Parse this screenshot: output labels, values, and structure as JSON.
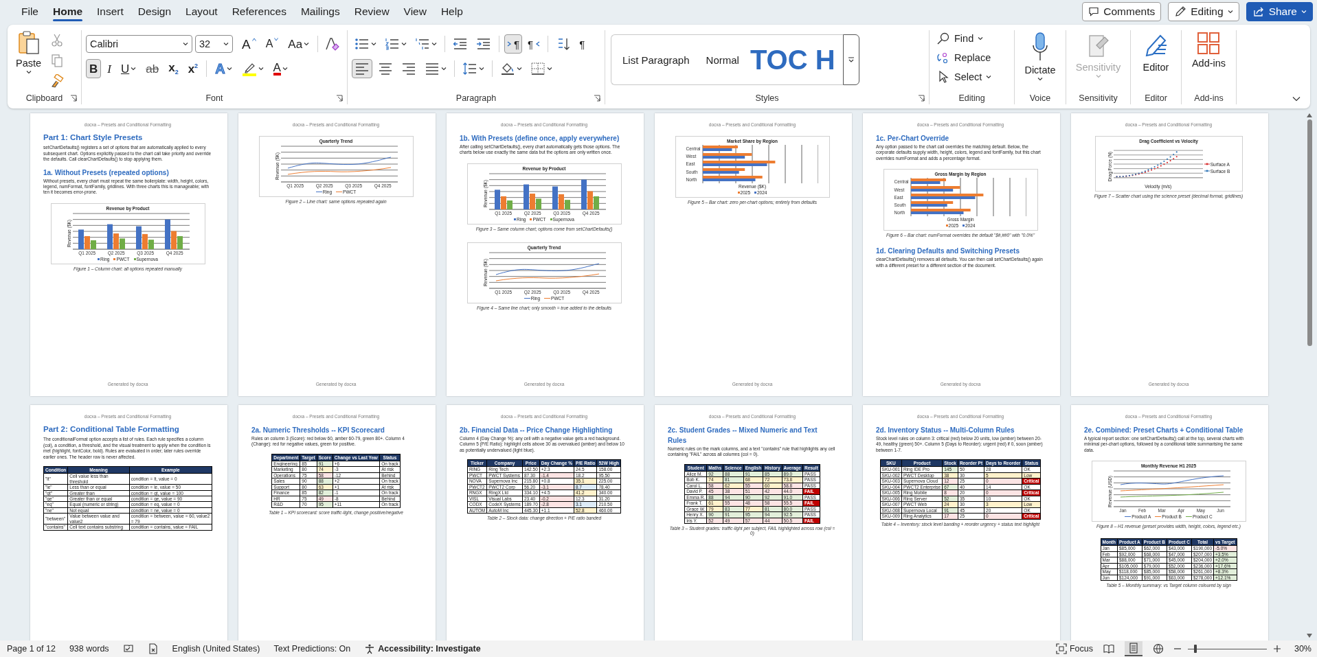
{
  "menu_tabs": [
    {
      "label": "File",
      "selected": false
    },
    {
      "label": "Home",
      "selected": true
    },
    {
      "label": "Insert",
      "selected": false
    },
    {
      "label": "Design",
      "selected": false
    },
    {
      "label": "Layout",
      "selected": false
    },
    {
      "label": "References",
      "selected": false
    },
    {
      "label": "Mailings",
      "selected": false
    },
    {
      "label": "Review",
      "selected": false
    },
    {
      "label": "View",
      "selected": false
    },
    {
      "label": "Help",
      "selected": false
    }
  ],
  "top_buttons": [
    {
      "label": "Comments",
      "kind": "comments"
    },
    {
      "label": "Editing",
      "kind": "editing"
    },
    {
      "label": "Share",
      "kind": "share"
    }
  ],
  "ribbon": {
    "clipboard": {
      "group": "Clipboard",
      "paste": "Paste"
    },
    "font": {
      "group": "Font",
      "name": "Calibri",
      "size": "32",
      "row1": [
        {
          "label": "A",
          "kind": "grow"
        },
        {
          "label": "A",
          "kind": "shrink"
        },
        {
          "label": "Aa",
          "kind": "case"
        }
      ],
      "row2": [
        {
          "label": "B",
          "kind": "bold",
          "selected": true
        },
        {
          "label": "I",
          "kind": "italic",
          "selected": false
        },
        {
          "label": "U",
          "kind": "underline",
          "selected": false
        },
        {
          "label": "ab",
          "kind": "strike",
          "selected": false
        },
        {
          "label": "x$_{2}$",
          "kind": "sub",
          "selected": false
        },
        {
          "label": "x$^{2}$",
          "kind": "sup",
          "selected": false
        },
        {
          "label": "A",
          "kind": "effects",
          "selected": false
        },
        {
          "kind": "highlight",
          "selected": false
        },
        {
          "label": "A",
          "kind": "fontcolor",
          "selected": false
        }
      ]
    },
    "paragraph": {
      "group": "Paragraph",
      "row1": [
        {
          "kind": "bullets",
          "selected": false
        },
        {
          "kind": "numbering",
          "selected": false
        },
        {
          "kind": "multilevel",
          "selected": false
        },
        {
          "kind": "outdent",
          "selected": false
        },
        {
          "kind": "indent",
          "selected": false
        },
        {
          "kind": "ltr",
          "label": "¶",
          "selected": true
        },
        {
          "kind": "rtl",
          "label": "¶",
          "selected": false
        },
        {
          "kind": "sort",
          "selected": false
        },
        {
          "kind": "marks",
          "label": "¶",
          "selected": false
        }
      ],
      "row2": [
        {
          "kind": "left",
          "selected": true
        },
        {
          "kind": "center",
          "selected": false
        },
        {
          "kind": "right",
          "selected": false
        },
        {
          "kind": "justify",
          "selected": false
        },
        {
          "kind": "spacing",
          "selected": false
        },
        {
          "kind": "shading",
          "selected": false
        },
        {
          "kind": "borders",
          "selected": false
        }
      ]
    },
    "styles": {
      "group": "Styles",
      "items": [
        {
          "label": "List Paragraph",
          "kind": "plain"
        },
        {
          "label": "Normal",
          "kind": "plain"
        },
        {
          "label": "TOC H",
          "kind": "heading"
        }
      ]
    },
    "editing": {
      "group": "Editing",
      "items": [
        {
          "label": "Find",
          "kind": "find"
        },
        {
          "label": "Replace",
          "kind": "replace"
        },
        {
          "label": "Select",
          "kind": "select"
        }
      ]
    },
    "big": [
      {
        "group": "Voice",
        "label": "Dictate",
        "kind": "mic",
        "disabled": false
      },
      {
        "group": "Sensitivity",
        "label": "Sensitivity",
        "kind": "sensitivity",
        "disabled": true
      },
      {
        "group": "Editor",
        "label": "Editor",
        "kind": "editor",
        "disabled": false
      },
      {
        "group": "Add-ins",
        "label": "Add-ins",
        "kind": "addins",
        "disabled": false
      }
    ]
  },
  "pages": [
    {
      "header": "docxa – Presets and Conditional Formatting",
      "footer": "Generated by docxa",
      "blocks": [
        {
          "kind": "h1",
          "text": "Part 1: Chart Style Presets"
        },
        {
          "kind": "para",
          "text": "setChartDefaults() registers a set of options that are automatically applied to every subsequent chart. Options explicitly passed to the chart call take priority and override the defaults. Call clearChartDefaults() to stop applying them."
        },
        {
          "kind": "h2",
          "text": "1a. Without Presets (repeated options)"
        },
        {
          "kind": "para",
          "text": "Without presets, every chart must repeat the same boilerplate: width, height, colors, legend, numFormat, fontFamily, gridlines. With three charts this is manageable; with ten it becomes error-prone."
        },
        {
          "kind": "chart",
          "chart": {
            "kind": "column",
            "title": "Revenue by Product",
            "ylabel": "Revenue ($K)",
            "categories": [
              "Q1 2025",
              "Q2 2025",
              "Q3 2025",
              "Q4 2025"
            ],
            "legend": [
              "Ring",
              "PWCT",
              "Supernova"
            ]
          }
        },
        {
          "kind": "caption",
          "text": "Figure 1 – Column chart: all options repeated manually"
        }
      ]
    },
    {
      "header": "docxa – Presets and Conditional Formatting",
      "footer": "Generated by docxa",
      "blocks": [
        {
          "kind": "chart",
          "chart": {
            "kind": "line",
            "title": "Quarterly Trend",
            "ylabel": "Revenue ($K)",
            "categories": [
              "Q1 2025",
              "Q2 2025",
              "Q3 2025",
              "Q4 2025"
            ],
            "legend": [
              "Ring",
              "PWCT"
            ]
          }
        },
        {
          "kind": "caption",
          "text": "Figure 2 – Line chart: same options repeated again"
        }
      ]
    },
    {
      "header": "docxa – Presets and Conditional Formatting",
      "footer": "Generated by docxa",
      "blocks": [
        {
          "kind": "h2",
          "text": "1b. With Presets (define once, apply everywhere)"
        },
        {
          "kind": "para",
          "text": "After calling setChartDefaults(), every chart automatically gets those options. The charts below use exactly the same data but the options are only written once."
        },
        {
          "kind": "chart",
          "chart": {
            "kind": "column",
            "title": "Revenue by Product",
            "ylabel": "Revenue ($K)",
            "categories": [
              "Q1 2025",
              "Q2 2025",
              "Q3 2025",
              "Q4 2025"
            ],
            "legend": [
              "Ring",
              "PWCT",
              "Supernova"
            ]
          }
        },
        {
          "kind": "caption",
          "text": "Figure 3 – Same column chart; options come from setChartDefaults()"
        },
        {
          "kind": "chart",
          "chart": {
            "kind": "line",
            "title": "Quarterly Trend",
            "ylabel": "Revenue ($K)",
            "categories": [
              "Q1 2025",
              "Q2 2025",
              "Q3 2025",
              "Q4 2025"
            ],
            "legend": [
              "Ring",
              "PWCT"
            ]
          }
        },
        {
          "kind": "caption",
          "text": "Figure 4 – Same line chart; only smooth = true added to the defaults"
        }
      ]
    },
    {
      "header": "docxa – Presets and Conditional Formatting",
      "footer": "Generated by docxa",
      "blocks": [
        {
          "kind": "chart",
          "chart": {
            "kind": "hbar",
            "title": "Market Share by Region",
            "xlabel": "Revenue ($K)",
            "categories": [
              "Central",
              "West",
              "East",
              "South",
              "North"
            ],
            "legend": [
              "2025",
              "2024"
            ]
          }
        },
        {
          "kind": "caption",
          "text": "Figure 5 – Bar chart: zero per-chart options; entirely from defaults"
        }
      ]
    },
    {
      "header": "docxa – Presets and Conditional Formatting",
      "footer": "Generated by docxa",
      "blocks": [
        {
          "kind": "h2",
          "text": "1c. Per-Chart Override"
        },
        {
          "kind": "para",
          "text": "Any option passed to the chart call overrides the matching default. Below, the corporate defaults supply width, height, colors, legend and fontFamily, but this chart overrides numFormat and adds a percentage format."
        },
        {
          "kind": "chart",
          "chart": {
            "kind": "hbar",
            "title": "Gross Margin by Region",
            "xlabel": "Gross Margin",
            "categories": [
              "Central",
              "West",
              "East",
              "South",
              "North"
            ],
            "legend": [
              "2025",
              "2024"
            ]
          }
        },
        {
          "kind": "caption",
          "text": "Figure 6 – Bar chart: numFormat overrides the default \"$#,##0\" with \"0.0%\""
        },
        {
          "kind": "h2",
          "text": "1d. Clearing Defaults and Switching Presets"
        },
        {
          "kind": "para",
          "text": "clearChartDefaults() removes all defaults. You can then call setChartDefaults() again with a different preset for a different section of the document."
        }
      ]
    },
    {
      "header": "docxa – Presets and Conditional Formatting",
      "footer": "Generated by docxa",
      "blocks": [
        {
          "kind": "chart",
          "chart": {
            "kind": "scatter",
            "title": "Drag Coefficient vs Velocity",
            "ylabel": "Drag Force (N)",
            "xlabel": "Velocity (m/s)",
            "legend": [
              "Surface A",
              "Surface B"
            ]
          }
        },
        {
          "kind": "caption",
          "text": "Figure 7 – Scatter chart using the science preset (decimal format, gridlines)"
        }
      ]
    },
    {
      "header": "docxa – Presets and Conditional Formatting",
      "blocks": [
        {
          "kind": "h1",
          "text": "Part 2: Conditional Table Formatting"
        },
        {
          "kind": "para",
          "text": "The conditionalFormat option accepts a list of rules. Each rule specifies a column (col), a condition, a threshold, and the visual treatment to apply when the condition is met (highlight, fontColor, bold). Rules are evaluated in order; later rules override earlier ones. The header row is never affected."
        },
        {
          "kind": "table",
          "columns": [
            "Condition",
            "Meaning",
            "Example"
          ],
          "rows": [
            [
              "\"lt\"",
              "Cell value less than threshold",
              "condition = lt, value = 0"
            ],
            [
              "\"le\"",
              "Less than or equal",
              "condition = le, value = 50"
            ],
            [
              "\"gt\"",
              "Greater than",
              "condition = gt, value = 100"
            ],
            [
              "\"ge\"",
              "Greater than or equal",
              "condition = ge, value = 90"
            ],
            [
              "\"eq\"",
              "Equal (numeric or string)",
              "condition = eq, value = 0"
            ],
            [
              "\"ne\"",
              "Not equal",
              "condition = ne, value = 0"
            ],
            [
              "\"between\"",
              "Value between value and value2",
              "condition = between, value = 60, value2 = 79"
            ],
            [
              "\"contains\"",
              "Cell text contains substring",
              "condition = contains, value = FAIL"
            ]
          ]
        }
      ]
    },
    {
      "header": "docxa – Presets and Conditional Formatting",
      "blocks": [
        {
          "kind": "h2",
          "text": "2a. Numeric Thresholds -- KPI Scorecard"
        },
        {
          "kind": "para",
          "text": "Rules on column 3 (Score): red below 60, amber 60-79, green 80+. Column 4 (Change): red for negative values, green for positive."
        },
        {
          "kind": "table",
          "columns": [
            "Department",
            "Target",
            "Score",
            "Change vs Last Year",
            "Status"
          ],
          "rows": [
            [
              "Engineering",
              "85",
              {
                "text": "91",
                "color": "#e2efda"
              },
              "+6",
              "On track"
            ],
            [
              "Marketing",
              "80",
              {
                "text": "74",
                "color": "#fff2cc"
              },
              "-3",
              "At risk"
            ],
            [
              "Operations",
              "75",
              {
                "text": "58",
                "color": "#fce4e4"
              },
              "-12",
              "Behind"
            ],
            [
              "Sales",
              "90",
              {
                "text": "88",
                "color": "#e2efda"
              },
              "+2",
              "On track"
            ],
            [
              "Support",
              "80",
              {
                "text": "63",
                "color": "#fff2cc"
              },
              "+1",
              "At risk"
            ],
            [
              "Finance",
              "85",
              {
                "text": "82",
                "color": "#e2efda"
              },
              "-1",
              "On track"
            ],
            [
              "HR",
              "75",
              {
                "text": "49",
                "color": "#fce4e4"
              },
              "-8",
              "Behind"
            ],
            [
              "R&D",
              "70",
              {
                "text": "95",
                "color": "#e2efda"
              },
              "+11",
              "On track"
            ]
          ]
        },
        {
          "kind": "caption",
          "text": "Table 1 – KPI scorecard: score traffic-light, change positive/negative"
        }
      ]
    },
    {
      "header": "docxa – Presets and Conditional Formatting",
      "blocks": [
        {
          "kind": "h2",
          "text": "2b. Financial Data -- Price Change Highlighting"
        },
        {
          "kind": "para",
          "text": "Column 4 (Day Change %): any cell with a negative value gets a red background. Column 5 (P/E Ratio): highlight cells above 30 as overvalued (amber) and below 10 as potentially undervalued (light blue)."
        },
        {
          "kind": "table",
          "columns": [
            "Ticker",
            "Company",
            "Price",
            "Day Change %",
            "P/E Ratio",
            "52W High"
          ],
          "rows": [
            [
              "RING",
              "Ring Tech",
              "142.50",
              "+2.3",
              "24.5",
              "158.00"
            ],
            [
              "PWCT",
              "PWCT Systems",
              "87.30",
              {
                "text": "-1.4",
                "color": "#fce4e4"
              },
              "18.2",
              "95.50"
            ],
            [
              "NOVA",
              "Supernova Inc",
              "215.80",
              "+0.8",
              {
                "text": "35.1",
                "color": "#fff2cc"
              },
              "225.00"
            ],
            [
              "PWCT2",
              "PWCT2 Corp",
              "56.20",
              {
                "text": "-3.1",
                "color": "#fce4e4"
              },
              {
                "text": "8.7",
                "color": "#ddebf7"
              },
              "78.40"
            ],
            [
              "RNGX",
              "RingX Ltd",
              "334.10",
              "+4.5",
              {
                "text": "41.2",
                "color": "#fff2cc"
              },
              "340.00"
            ],
            [
              "VISL",
              "Visual Labs",
              "23.40",
              {
                "text": "-0.2",
                "color": "#fce4e4"
              },
              "12.3",
              "31.20"
            ],
            [
              "CODX",
              "CodeX Systems",
              "189.70",
              {
                "text": "-2.8",
                "color": "#fce4e4"
              },
              {
                "text": "3.1",
                "color": "#ddebf7"
              },
              "210.50"
            ],
            [
              "AUTOM",
              "AutoM Inc",
              "445.30",
              "+1.1",
              {
                "text": "52.8",
                "color": "#fff2cc"
              },
              "460.00"
            ]
          ]
        },
        {
          "kind": "caption",
          "text": "Table 2 – Stock data: change direction + P/E ratio banded"
        }
      ]
    },
    {
      "header": "docxa – Presets and Conditional Formatting",
      "blocks": [
        {
          "kind": "h2",
          "text": "2c. Student Grades -- Mixed Numeric and Text Rules"
        },
        {
          "kind": "para",
          "text": "Numeric rules on the mark columns, and a text \"contains\" rule that highlights any cell containing \"FAIL\" across all columns (col = 0)."
        },
        {
          "kind": "table",
          "columns": [
            "Student",
            "Maths",
            "Science",
            "English",
            "History",
            "Average",
            "Result"
          ],
          "rows": [
            [
              "Alice M.",
              {
                "text": "92",
                "color": "#e2efda"
              },
              {
                "text": "88",
                "color": "#e2efda"
              },
              {
                "text": "91",
                "color": "#e2efda"
              },
              {
                "text": "85",
                "color": "#e2efda"
              },
              {
                "text": "89.0",
                "color": "#e2efda"
              },
              "PASS"
            ],
            [
              "Bob K.",
              {
                "text": "74",
                "color": "#fff2cc"
              },
              {
                "text": "81",
                "color": "#e2efda"
              },
              {
                "text": "68",
                "color": "#fff2cc"
              },
              {
                "text": "72",
                "color": "#fff2cc"
              },
              {
                "text": "73.8",
                "color": "#fff2cc"
              },
              "PASS"
            ],
            [
              "Carol L.",
              {
                "text": "58",
                "color": "#fce4e4"
              },
              {
                "text": "62",
                "color": "#fff2cc"
              },
              {
                "text": "55",
                "color": "#fce4e4"
              },
              {
                "text": "60",
                "color": "#fff2cc"
              },
              {
                "text": "58.8",
                "color": "#fce4e4"
              },
              "PASS"
            ],
            [
              "David P.",
              {
                "text": "45",
                "color": "#fce4e4"
              },
              {
                "text": "38",
                "color": "#fce4e4"
              },
              {
                "text": "51",
                "color": "#fce4e4"
              },
              {
                "text": "42",
                "color": "#fce4e4"
              },
              {
                "text": "44.0",
                "color": "#fce4e4"
              },
              {
                "text": "FAIL",
                "color": "#c00000"
              }
            ],
            [
              "Emma R.",
              {
                "text": "88",
                "color": "#e2efda"
              },
              {
                "text": "94",
                "color": "#e2efda"
              },
              {
                "text": "90",
                "color": "#e2efda"
              },
              {
                "text": "92",
                "color": "#e2efda"
              },
              {
                "text": "91.0",
                "color": "#e2efda"
              },
              "PASS"
            ],
            [
              "Frank T.",
              {
                "text": "61",
                "color": "#fff2cc"
              },
              {
                "text": "55",
                "color": "#fce4e4"
              },
              {
                "text": "48",
                "color": "#fce4e4"
              },
              {
                "text": "58",
                "color": "#fce4e4"
              },
              {
                "text": "55.5",
                "color": "#fce4e4"
              },
              {
                "text": "FAIL",
                "color": "#c00000"
              }
            ],
            [
              "Grace W.",
              {
                "text": "79",
                "color": "#fff2cc"
              },
              {
                "text": "83",
                "color": "#e2efda"
              },
              {
                "text": "77",
                "color": "#fff2cc"
              },
              {
                "text": "81",
                "color": "#e2efda"
              },
              {
                "text": "80.0",
                "color": "#e2efda"
              },
              "PASS"
            ],
            [
              "Henry X.",
              {
                "text": "90",
                "color": "#e2efda"
              },
              {
                "text": "91",
                "color": "#e2efda"
              },
              {
                "text": "95",
                "color": "#e2efda"
              },
              {
                "text": "94",
                "color": "#e2efda"
              },
              {
                "text": "92.5",
                "color": "#e2efda"
              },
              "PASS"
            ],
            [
              "Iris Y.",
              {
                "text": "52",
                "color": "#fce4e4"
              },
              {
                "text": "49",
                "color": "#fce4e4"
              },
              {
                "text": "57",
                "color": "#fce4e4"
              },
              {
                "text": "44",
                "color": "#fce4e4"
              },
              {
                "text": "50.5",
                "color": "#fce4e4"
              },
              {
                "text": "FAIL",
                "color": "#c00000"
              }
            ]
          ]
        },
        {
          "kind": "caption",
          "text": "Table 3 – Student grades: traffic-light per subject, FAIL highlighted across row (col = 0)"
        }
      ]
    },
    {
      "header": "docxa – Presets and Conditional Formatting",
      "blocks": [
        {
          "kind": "h2",
          "text": "2d. Inventory Status -- Multi-Column Rules"
        },
        {
          "kind": "para",
          "text": "Stock level rules on column 3: critical (red) below 20 units, low (amber) between 20-49, healthy (green) 50+. Column 5 (Days to Reorder): urgent (red) if 0, soon (amber) between 1-7."
        },
        {
          "kind": "table",
          "columns": [
            "SKU",
            "Product",
            "Stock",
            "Reorder Pt",
            "Days to Reorder",
            "Status"
          ],
          "rows": [
            [
              "SKU-001",
              "Ring IDE Pro",
              {
                "text": "145",
                "color": "#e2efda"
              },
              "50",
              "28",
              "OK"
            ],
            [
              "SKU-002",
              "PWCT Desktop",
              {
                "text": "38",
                "color": "#fff2cc"
              },
              "30",
              {
                "text": "5",
                "color": "#fff2cc"
              },
              {
                "text": "Low",
                "color": "#fff2cc"
              }
            ],
            [
              "SKU-003",
              "Supernova Cloud",
              {
                "text": "12",
                "color": "#fce4e4"
              },
              "25",
              {
                "text": "0",
                "color": "#fce4e4"
              },
              {
                "text": "Critical",
                "color": "#c00000"
              }
            ],
            [
              "SKU-004",
              "PWCT2 Enterprise",
              {
                "text": "67",
                "color": "#e2efda"
              },
              "40",
              "14",
              "OK"
            ],
            [
              "SKU-005",
              "Ring Mobile",
              {
                "text": "8",
                "color": "#fce4e4"
              },
              "20",
              {
                "text": "0",
                "color": "#fce4e4"
              },
              {
                "text": "Critical",
                "color": "#c00000"
              }
            ],
            [
              "SKU-006",
              "Ring Server",
              {
                "text": "52",
                "color": "#e2efda"
              },
              "35",
              "10",
              "OK"
            ],
            [
              "SKU-007",
              "PWCT Web",
              {
                "text": "24",
                "color": "#fff2cc"
              },
              "30",
              {
                "text": "3",
                "color": "#fff2cc"
              },
              {
                "text": "Low",
                "color": "#fff2cc"
              }
            ],
            [
              "SKU-008",
              "Supernova Local",
              {
                "text": "91",
                "color": "#e2efda"
              },
              "45",
              "20",
              "OK"
            ],
            [
              "SKU-009",
              "Ring Analytics",
              {
                "text": "17",
                "color": "#fce4e4"
              },
              "25",
              {
                "text": "0",
                "color": "#fce4e4"
              },
              {
                "text": "Critical",
                "color": "#c00000"
              }
            ]
          ]
        },
        {
          "kind": "caption",
          "text": "Table 4 – Inventory: stock level banding + reorder urgency + status text highlight"
        }
      ]
    },
    {
      "header": "docxa – Presets and Conditional Formatting",
      "blocks": [
        {
          "kind": "h2",
          "text": "2e. Combined: Preset Charts + Conditional Table"
        },
        {
          "kind": "para",
          "text": "A typical report section: one setChartDefaults() call at the top, several charts with minimal per-chart options, followed by a conditional table summarising the same data."
        },
        {
          "kind": "chart",
          "chart": {
            "kind": "line3",
            "title": "Monthly Revenue H1 2025",
            "ylabel": "Revenue (USD)",
            "categories": [
              "Jan",
              "Feb",
              "Mar",
              "Apr",
              "May",
              "Jun"
            ],
            "legend": [
              "Product A",
              "Product B",
              "Product C"
            ]
          }
        },
        {
          "kind": "caption",
          "text": "Figure 8 – H1 revenue (preset provides width, height, colors, legend etc.)"
        },
        {
          "kind": "table",
          "columns": [
            "Month",
            "Product A",
            "Product B",
            "Product C",
            "Total",
            "vs Target"
          ],
          "rows": [
            [
              "Jan",
              "$85,000",
              "$62,000",
              "$43,000",
              "$190,000",
              {
                "text": "-5.0%",
                "color": "#fce4e4"
              }
            ],
            [
              "Feb",
              "$92,000",
              "$68,000",
              "$47,000",
              "$207,000",
              {
                "text": "+3.5%",
                "color": "#e2efda"
              }
            ],
            [
              "Mar",
              "$88,000",
              "$71,000",
              "$45,000",
              "$204,000",
              {
                "text": "+2.0%",
                "color": "#e2efda"
              }
            ],
            [
              "Apr",
              "$105,000",
              "$79,000",
              "$52,000",
              "$236,000",
              {
                "text": "+17.6%",
                "color": "#e2efda"
              }
            ],
            [
              "May",
              "$118,000",
              "$85,000",
              "$58,000",
              "$261,000",
              {
                "text": "+8.3%",
                "color": "#e2efda"
              }
            ],
            [
              "Jun",
              "$124,000",
              "$91,000",
              "$63,000",
              "$278,000",
              {
                "text": "+12.1%",
                "color": "#e2efda"
              }
            ]
          ]
        },
        {
          "kind": "caption",
          "text": "Table 5 – Monthly summary: vs Target column coloured by sign"
        }
      ]
    }
  ],
  "status": {
    "page": "Page 1 of 12",
    "words": "938 words",
    "language": "English (United States)",
    "predictions": "Text Predictions: On",
    "accessibility": "Accessibility: Investigate",
    "focus": "Focus",
    "views": [
      {
        "kind": "read",
        "selected": false
      },
      {
        "kind": "print",
        "selected": true
      },
      {
        "kind": "web",
        "selected": false
      }
    ],
    "zoom": {
      "level": 0.1,
      "reading": "30%"
    }
  }
}
